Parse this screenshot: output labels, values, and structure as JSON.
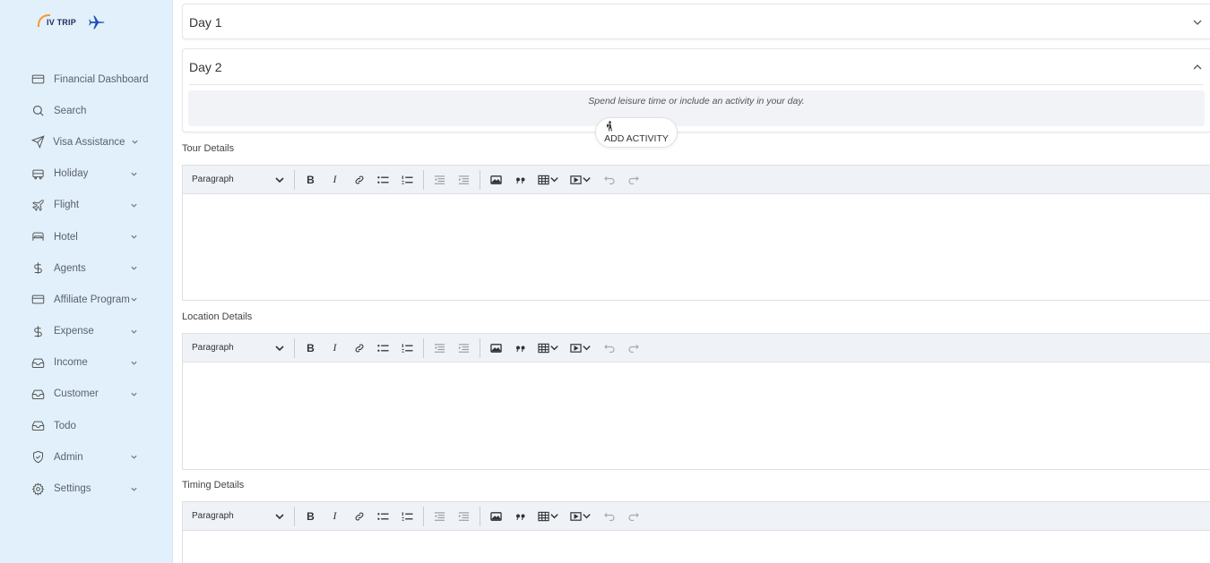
{
  "brand": {
    "logo_text": "IV TRIP"
  },
  "sidebar": {
    "items": [
      {
        "label": "Financial Dashboard",
        "icon": "card-icon",
        "has_chevron": false
      },
      {
        "label": "Search",
        "icon": "search-icon",
        "has_chevron": false
      },
      {
        "label": "Visa Assistance",
        "icon": "send-icon",
        "has_chevron": true
      },
      {
        "label": "Holiday",
        "icon": "bus-icon",
        "has_chevron": true
      },
      {
        "label": "Flight",
        "icon": "plane-icon",
        "has_chevron": true
      },
      {
        "label": "Hotel",
        "icon": "bed-icon",
        "has_chevron": true
      },
      {
        "label": "Agents",
        "icon": "dollar-icon",
        "has_chevron": true
      },
      {
        "label": "Affiliate Program",
        "icon": "card-icon",
        "has_chevron": true
      },
      {
        "label": "Expense",
        "icon": "dollar-icon",
        "has_chevron": true
      },
      {
        "label": "Income",
        "icon": "inbox-icon",
        "has_chevron": true
      },
      {
        "label": "Customer",
        "icon": "inbox-icon",
        "has_chevron": true
      },
      {
        "label": "Todo",
        "icon": "inbox-icon",
        "has_chevron": false
      },
      {
        "label": "Admin",
        "icon": "shield-icon",
        "has_chevron": true
      },
      {
        "label": "Settings",
        "icon": "gear-icon",
        "has_chevron": true
      }
    ]
  },
  "days": {
    "day1": {
      "title": "Day 1",
      "expanded": false
    },
    "day2": {
      "title": "Day 2",
      "expanded": true,
      "leisure_text": "Spend leisure time or include an activity in your day.",
      "add_activity_label": "ADD ACTIVITY"
    }
  },
  "editors": {
    "format_option": "Paragraph",
    "tour": {
      "label": "Tour Details"
    },
    "location": {
      "label": "Location Details"
    },
    "timing": {
      "label": "Timing Details"
    }
  },
  "colors": {
    "sidebar_bg": "#e2f0fb",
    "toolbar_bg": "#eff3f8",
    "brand_navy": "#1d2a5c",
    "brand_orange": "#f29a2e",
    "plane_blue": "#1f4fb8"
  }
}
